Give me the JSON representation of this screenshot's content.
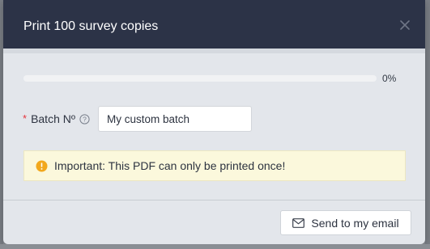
{
  "dialog": {
    "title": "Print 100 survey copies",
    "close_icon": "close-icon"
  },
  "progress": {
    "value_percent": 0,
    "label": "0%",
    "color": "#3a7bd5"
  },
  "batch_field": {
    "required_mark": "*",
    "label": "Batch Nº",
    "help_icon": "question-circle-icon",
    "value": "My custom batch"
  },
  "alert": {
    "icon": "warning-circle-icon",
    "icon_color": "#f2a81d",
    "text": "Important: This PDF can only be printed once!",
    "background": "#fbf8dc"
  },
  "footer": {
    "email_icon": "envelope-icon",
    "send_email_label": "Send to my email"
  },
  "colors": {
    "header_bg": "#2c3347",
    "body_bg": "#e3e6eb",
    "required": "#e5343c"
  }
}
